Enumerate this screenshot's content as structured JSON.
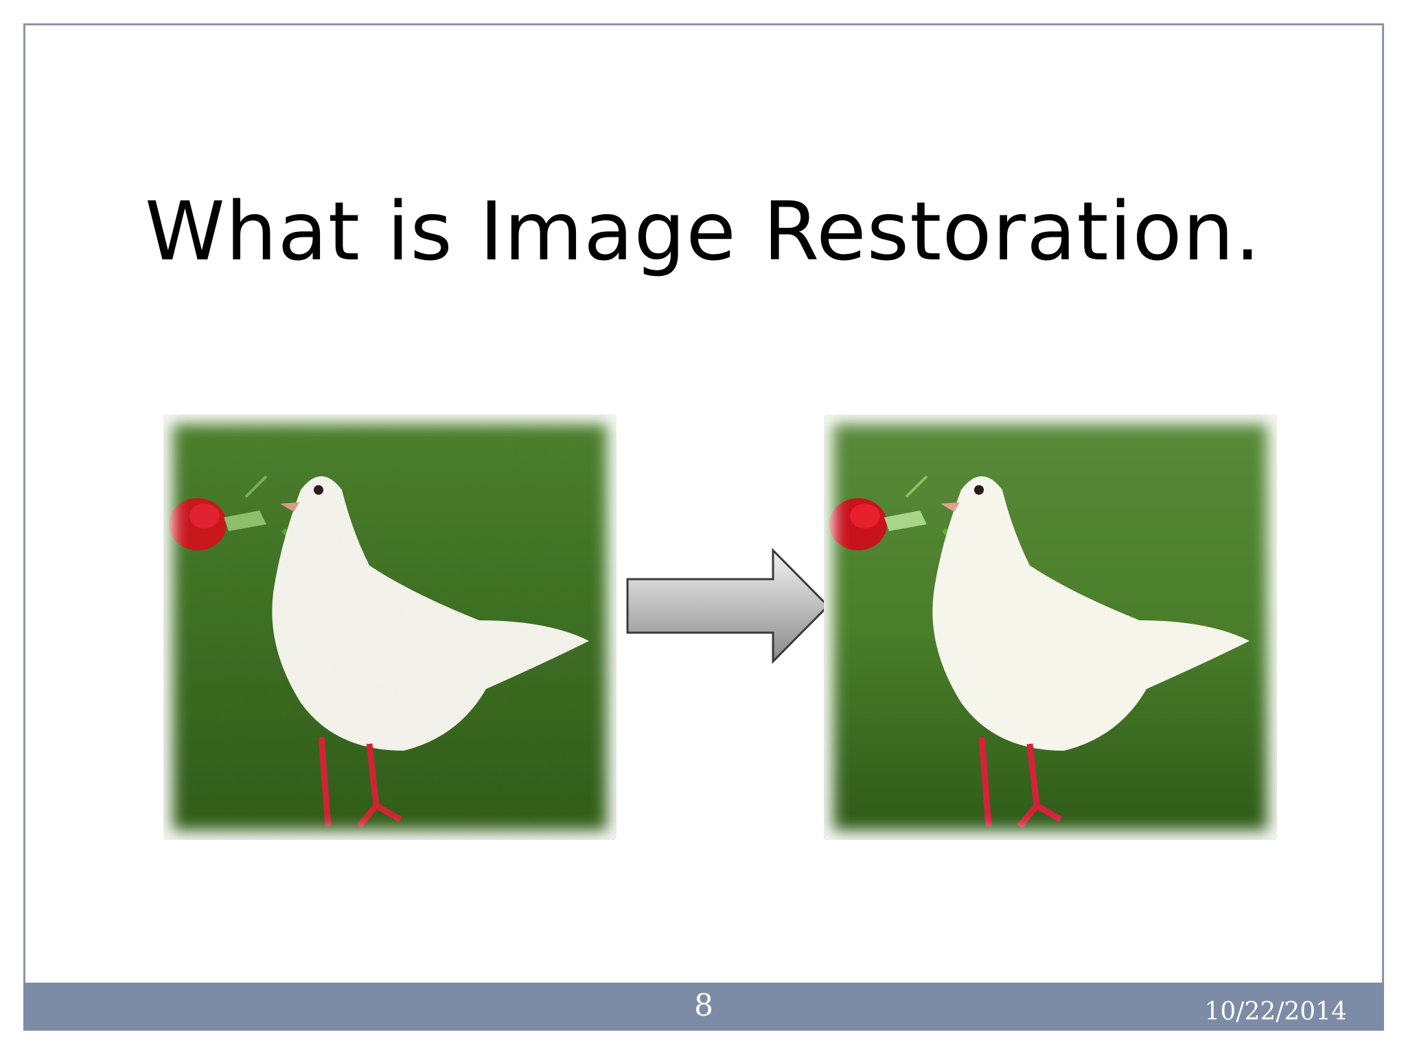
{
  "slide": {
    "title": "What is Image Restoration.",
    "page_number": "8",
    "date": "10/22/2014"
  },
  "images": {
    "left": {
      "icon": "degraded-dove-photo"
    },
    "right": {
      "icon": "restored-dove-photo"
    }
  },
  "arrow": {
    "icon": "right-arrow-icon"
  },
  "colors": {
    "frame": "#8a96a8",
    "footer": "#7d8ca6",
    "grass": "#3f7a22",
    "rose": "#c8121c"
  }
}
